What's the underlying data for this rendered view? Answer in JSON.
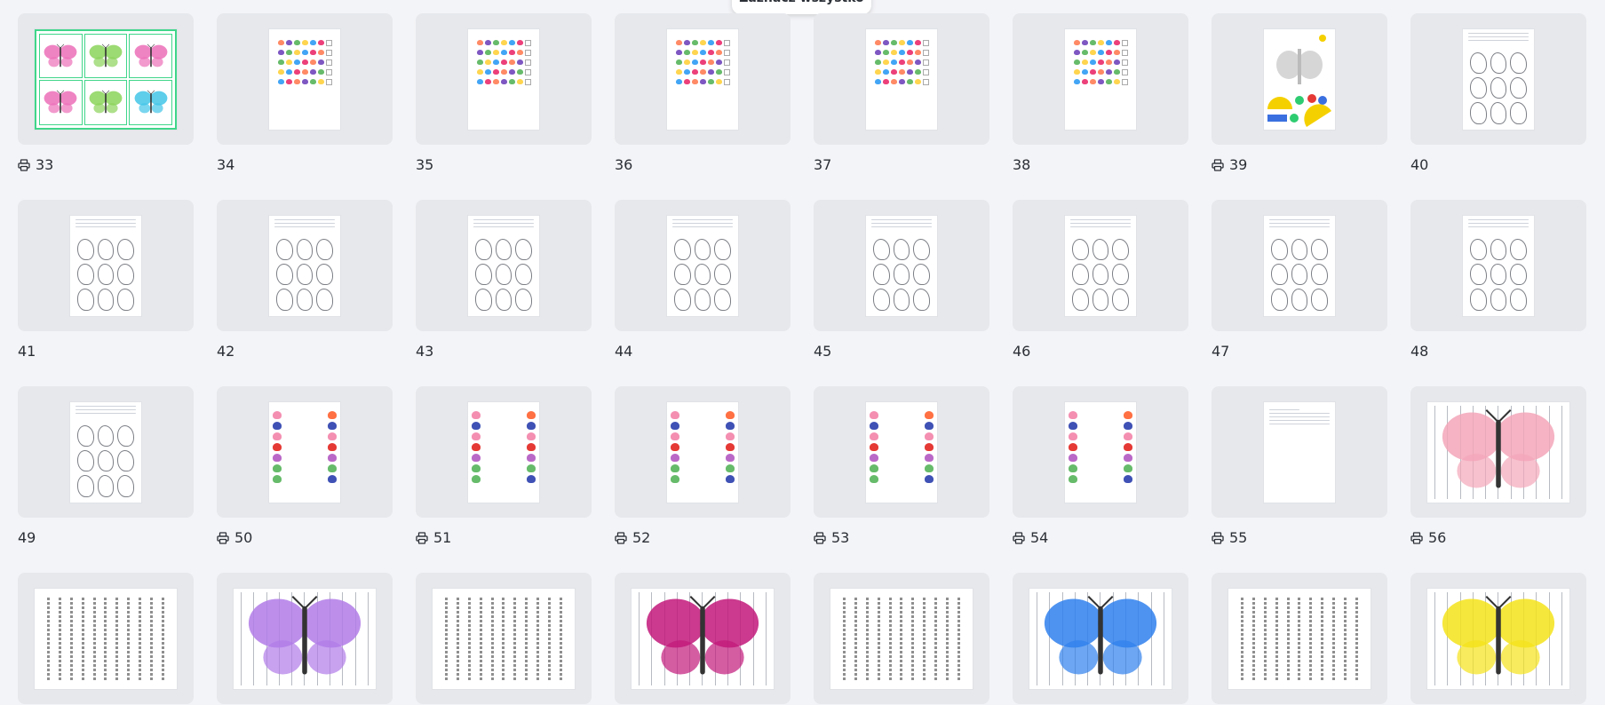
{
  "toast": {
    "label": "Zaznacz wszystko"
  },
  "colors": {
    "background": "#f3f4f7",
    "thumb_bg": "#e6e8ec",
    "accent_green": "#3fd68a"
  },
  "grid": {
    "items": [
      {
        "number": "33",
        "printed": true,
        "kind": "cards"
      },
      {
        "number": "34",
        "printed": false,
        "kind": "table"
      },
      {
        "number": "35",
        "printed": false,
        "kind": "table"
      },
      {
        "number": "36",
        "printed": false,
        "kind": "table"
      },
      {
        "number": "37",
        "printed": false,
        "kind": "table"
      },
      {
        "number": "38",
        "printed": false,
        "kind": "table"
      },
      {
        "number": "39",
        "printed": true,
        "kind": "shapes"
      },
      {
        "number": "40",
        "printed": false,
        "kind": "outlines"
      },
      {
        "number": "41",
        "printed": false,
        "kind": "outlines"
      },
      {
        "number": "42",
        "printed": false,
        "kind": "outlines"
      },
      {
        "number": "43",
        "printed": false,
        "kind": "outlines"
      },
      {
        "number": "44",
        "printed": false,
        "kind": "outlines"
      },
      {
        "number": "45",
        "printed": false,
        "kind": "outlines"
      },
      {
        "number": "46",
        "printed": false,
        "kind": "outlines"
      },
      {
        "number": "47",
        "printed": false,
        "kind": "outlines"
      },
      {
        "number": "48",
        "printed": false,
        "kind": "outlines"
      },
      {
        "number": "49",
        "printed": false,
        "kind": "outlines"
      },
      {
        "number": "50",
        "printed": true,
        "kind": "matching"
      },
      {
        "number": "51",
        "printed": true,
        "kind": "matching"
      },
      {
        "number": "52",
        "printed": true,
        "kind": "matching"
      },
      {
        "number": "53",
        "printed": true,
        "kind": "matching"
      },
      {
        "number": "54",
        "printed": true,
        "kind": "matching"
      },
      {
        "number": "55",
        "printed": true,
        "kind": "text"
      },
      {
        "number": "56",
        "printed": true,
        "kind": "puzzle-pink"
      },
      {
        "number": "",
        "printed": false,
        "kind": "strips"
      },
      {
        "number": "",
        "printed": false,
        "kind": "puzzle-purple"
      },
      {
        "number": "",
        "printed": false,
        "kind": "strips"
      },
      {
        "number": "",
        "printed": false,
        "kind": "puzzle-magenta"
      },
      {
        "number": "",
        "printed": false,
        "kind": "strips"
      },
      {
        "number": "",
        "printed": false,
        "kind": "puzzle-blue"
      },
      {
        "number": "",
        "printed": false,
        "kind": "strips"
      },
      {
        "number": "",
        "printed": false,
        "kind": "puzzle-yellow"
      }
    ]
  },
  "icons": {
    "print": "printer-icon"
  }
}
